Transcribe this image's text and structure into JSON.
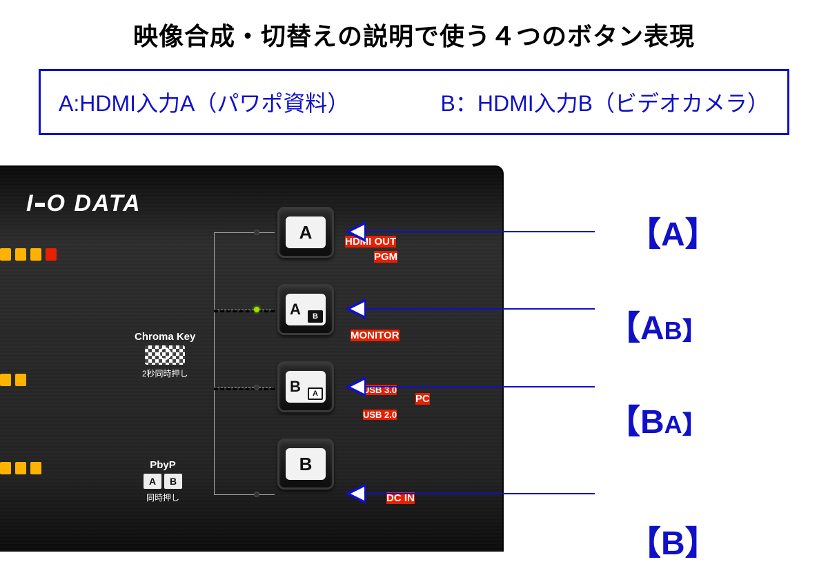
{
  "title": "映像合成・切替えの説明で使う４つのボタン表現",
  "legend": {
    "a": "A:HDMI入力A（パワポ資料）",
    "b": "B：HDMI入力B（ビデオカメラ）"
  },
  "device": {
    "brand": "I•O DATA",
    "side_labels": {
      "hdmi_out": "HDMI OUT",
      "pgm": "PGM",
      "monitor": "MONITOR",
      "usb30": "USB 3.0",
      "pc": "PC",
      "usb20": "USB 2.0",
      "dcin": "DC IN"
    },
    "chroma": {
      "title": "Chroma Key",
      "sub": "2秒同時押し"
    },
    "pbyp": {
      "title": "PbyP",
      "a": "A",
      "b": "B",
      "sub": "同時押し"
    },
    "buttons": {
      "a": "A",
      "ab_main": "A",
      "ab_sub": "B",
      "ba_main": "B",
      "ba_sub": "A",
      "b": "B"
    }
  },
  "pointer_labels": {
    "a": "【A】",
    "ab": "【A",
    "ab_small": "B】",
    "ba": "【B",
    "ba_small": "A】",
    "b": "【B】"
  }
}
